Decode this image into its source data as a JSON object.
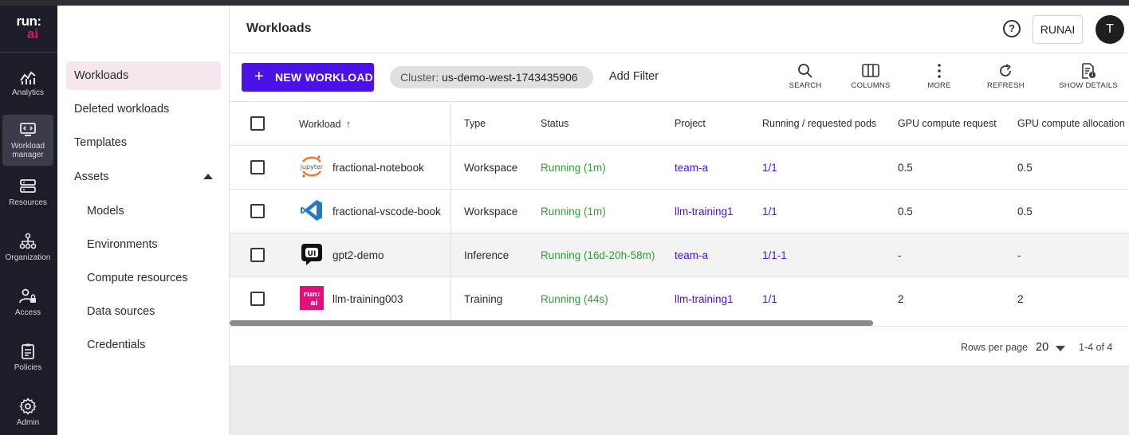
{
  "brand": {
    "line1": "run:",
    "line2": "ai"
  },
  "rail": [
    {
      "label": "Analytics",
      "icon": "analytics-icon"
    },
    {
      "label": "Workload manager",
      "icon": "workload-manager-icon",
      "active": true
    },
    {
      "label": "Resources",
      "icon": "resources-icon"
    },
    {
      "label": "Organization",
      "icon": "organization-icon"
    },
    {
      "label": "Access",
      "icon": "access-icon"
    },
    {
      "label": "Policies",
      "icon": "policies-icon"
    },
    {
      "label": "Admin",
      "icon": "gear-icon"
    }
  ],
  "nav": {
    "workloads": "Workloads",
    "deleted": "Deleted workloads",
    "templates": "Templates",
    "assets": "Assets",
    "models": "Models",
    "environments": "Environments",
    "compute": "Compute resources",
    "datasources": "Data sources",
    "credentials": "Credentials"
  },
  "header": {
    "title": "Workloads",
    "help": "?",
    "tenant": "RUNAI",
    "avatar": "T"
  },
  "toolbar": {
    "new_workload": "NEW WORKLOAD",
    "cluster_label": "Cluster:",
    "cluster_value": "us-demo-west-1743435906",
    "add_filter": "Add Filter",
    "search": "SEARCH",
    "columns": "COLUMNS",
    "more": "MORE",
    "refresh": "REFRESH",
    "show_details": "SHOW DETAILS"
  },
  "table": {
    "headers": {
      "workload": "Workload",
      "type": "Type",
      "status": "Status",
      "project": "Project",
      "pods": "Running / requested pods",
      "gpu_request": "GPU compute request",
      "gpu_alloc": "GPU compute allocation"
    },
    "rows": [
      {
        "name": "fractional-notebook",
        "icon": "jupyter-icon",
        "type": "Workspace",
        "status": "Running (1m)",
        "project": "team-a",
        "pods": "1/1",
        "gpu_request": "0.5",
        "gpu_alloc": "0.5"
      },
      {
        "name": "fractional-vscode-book",
        "icon": "vscode-icon",
        "type": "Workspace",
        "status": "Running (1m)",
        "project": "llm-training1",
        "pods": "1/1",
        "gpu_request": "0.5",
        "gpu_alloc": "0.5"
      },
      {
        "name": "gpt2-demo",
        "icon": "gradio-ui-icon",
        "type": "Inference",
        "status": "Running (16d-20h-58m)",
        "project": "team-a",
        "pods": "1/1-1",
        "gpu_request": "-",
        "gpu_alloc": "-"
      },
      {
        "name": "llm-training003",
        "icon": "runai-logo-icon",
        "type": "Training",
        "status": "Running (44s)",
        "project": "llm-training1",
        "pods": "1/1",
        "gpu_request": "2",
        "gpu_alloc": "2"
      }
    ]
  },
  "pagination": {
    "rows_per_page_label": "Rows per page",
    "rows_per_page": "20",
    "range": "1-4 of 4"
  },
  "colors": {
    "accent": "#4b12e8",
    "status_running": "#2e9f35",
    "brand_pink": "#e3107a",
    "rail_bg": "#1c1d26"
  }
}
